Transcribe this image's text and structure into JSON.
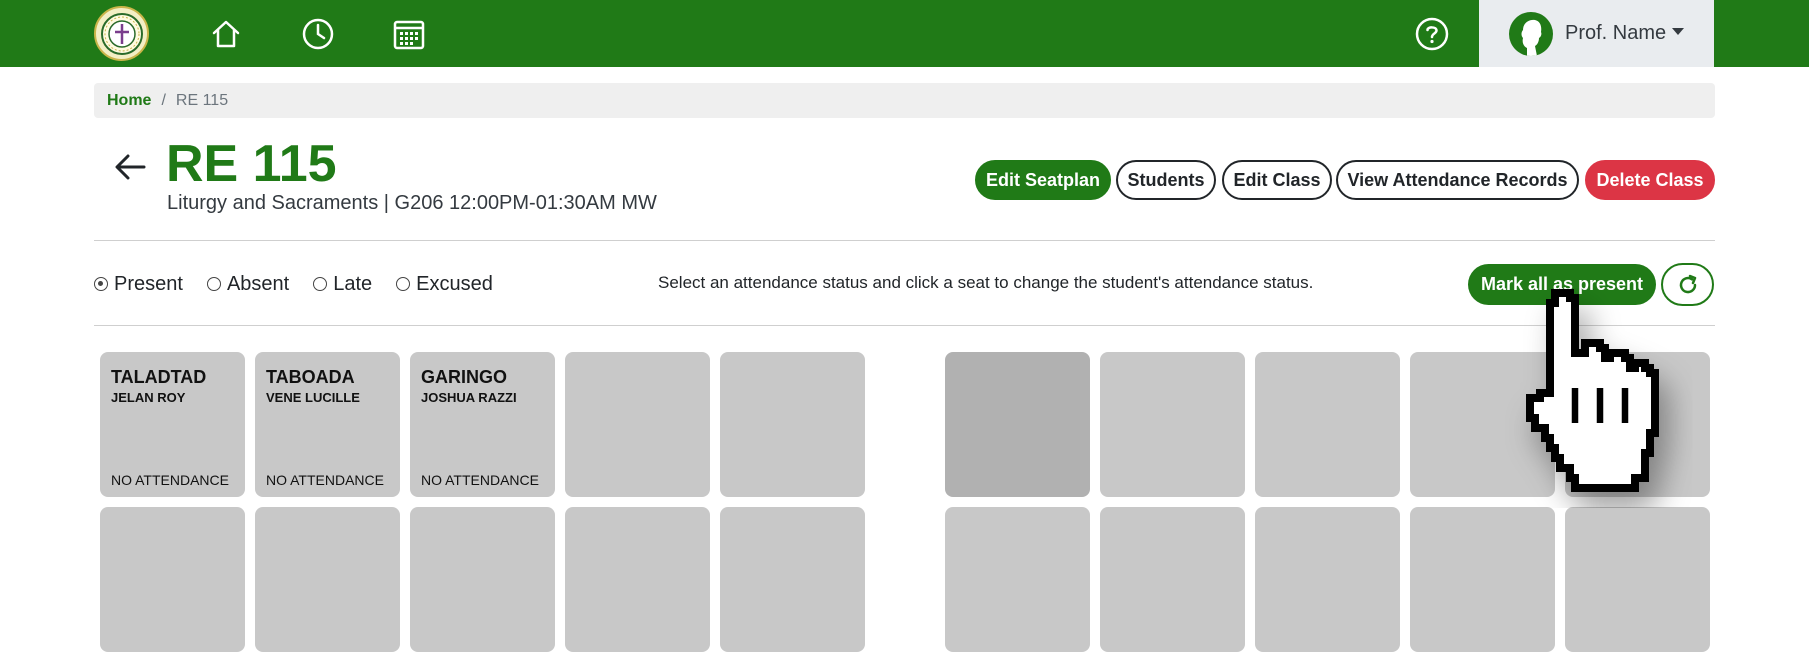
{
  "topbar": {
    "icons": [
      "logo-icon",
      "home-icon",
      "clock-icon",
      "calendar-icon",
      "help-icon"
    ],
    "profile_name": "Prof. Name"
  },
  "breadcrumb": {
    "home": "Home",
    "separator": "/",
    "current": "RE 115"
  },
  "header": {
    "class_code": "RE 115",
    "class_details": "Liturgy and Sacraments | G206 12:00PM-01:30AM MW"
  },
  "actions": {
    "edit_seatplan": "Edit Seatplan",
    "students": "Students",
    "edit_class": "Edit Class",
    "view_attendance": "View Attendance Records",
    "delete_class": "Delete Class"
  },
  "attendance": {
    "options": [
      "Present",
      "Absent",
      "Late",
      "Excused"
    ],
    "selected": "Present",
    "hint": "Select an attendance status and click a seat to change the student's attendance status.",
    "mark_all": "Mark all as present"
  },
  "seats": [
    {
      "last": "TALADTAD",
      "first": "JELAN ROY",
      "status": "NO ATTENDANCE"
    },
    {
      "last": "TABOADA",
      "first": "VENE LUCILLE",
      "status": "NO ATTENDANCE"
    },
    {
      "last": "GARINGO",
      "first": "JOSHUA RAZZI",
      "status": "NO ATTENDANCE"
    }
  ],
  "colors": {
    "primary_green": "#207a17",
    "danger_red": "#dc3545",
    "seat_gray": "#c8c8c8"
  }
}
